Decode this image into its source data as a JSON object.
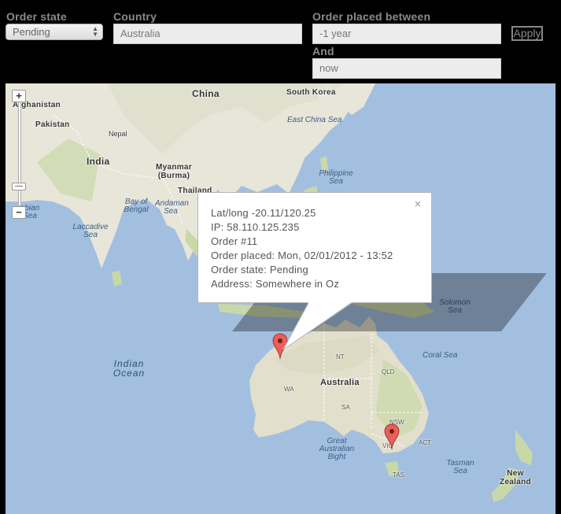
{
  "filters": {
    "order_state": {
      "label": "Order state",
      "value": "Pending"
    },
    "country": {
      "label": "Country",
      "value": "Australia"
    },
    "date_range": {
      "label": "Order placed between",
      "from": "-1 year",
      "and_label": "And",
      "to": "now"
    },
    "apply_label": "Apply"
  },
  "map": {
    "labels": {
      "afghanistan": "Afghanistan",
      "pakistan": "Pakistan",
      "nepal": "Nepal",
      "india": "India",
      "china": "China",
      "south_korea": "South Korea",
      "east_china_sea": "East China Sea",
      "myanmar": "Myanmar (Burma)",
      "thailand": "Thailand",
      "bay_of_bengal": "Bay of Bengal",
      "andaman_sea": "Andaman Sea",
      "arabian_sea": "abian Sea",
      "laccadive_sea": "Laccadive Sea",
      "philippine_sea": "Philippine Sea",
      "indian_ocean": "Indian Ocean",
      "solomon_sea": "Solomon Sea",
      "coral_sea": "Coral Sea",
      "australia": "Australia",
      "nt": "NT",
      "qld": "QLD",
      "wa": "WA",
      "sa": "SA",
      "nsw": "NSW",
      "act": "ACT",
      "vic": "VIC",
      "tas": "TAS",
      "great_australian_bight": "Great Australian Bight",
      "tasman_sea": "Tasman Sea",
      "new_zealand": "New Zealand"
    },
    "zoom": {
      "in": "+",
      "out": "−"
    },
    "info_window": {
      "close": "×",
      "lines": [
        "Lat/long -20.11/120.25",
        "IP: 58.110.125.235",
        "Order #11",
        "Order placed: Mon, 02/01/2012 - 13:52",
        "Order state: Pending",
        "Address: Somewhere in Oz"
      ]
    },
    "colors": {
      "water": "#a3bfdf",
      "land": "#e8e6d9",
      "land_green": "#c9d8a8",
      "marker": "#e8605a"
    }
  }
}
